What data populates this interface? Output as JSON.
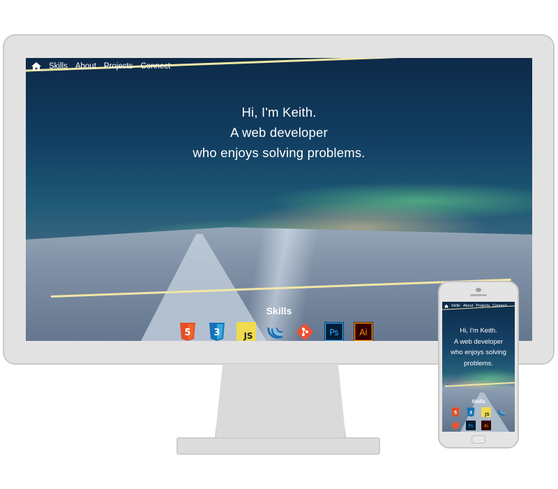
{
  "desktop": {
    "nav": {
      "home_icon": "home-icon",
      "items": [
        "Skills",
        "About",
        "Projects",
        "Connect"
      ]
    },
    "hero": {
      "line1": "Hi, I'm Keith.",
      "line2": "A web developer",
      "line3": "who enjoys solving problems."
    },
    "skills_title": "Skills",
    "skills": [
      {
        "name": "html5",
        "label": "5",
        "color": "#e44d26"
      },
      {
        "name": "css3",
        "label": "3",
        "color": "#1572b6"
      },
      {
        "name": "javascript",
        "label": "JS",
        "color": "#f0db4f"
      },
      {
        "name": "jquery",
        "label": "",
        "color": "#1d6fb5"
      },
      {
        "name": "git",
        "label": "",
        "color": "#f05033"
      },
      {
        "name": "photoshop",
        "label": "Ps",
        "color": "#31a8ff"
      },
      {
        "name": "illustrator",
        "label": "Ai",
        "color": "#ff9a00"
      }
    ]
  },
  "mobile": {
    "nav": {
      "home_icon": "home-icon",
      "items": [
        "Skills",
        "About",
        "Projects",
        "Connect"
      ]
    },
    "hero": {
      "line1": "Hi, I'm Keith.",
      "line2": "A web developer",
      "line3": "who enjoys solving",
      "line4": "problems."
    },
    "skills_title": "Skills"
  },
  "colors": {
    "accent_stripe": "#f2e7a6",
    "frame": "#e2e2e2",
    "text": "#ffffff"
  }
}
